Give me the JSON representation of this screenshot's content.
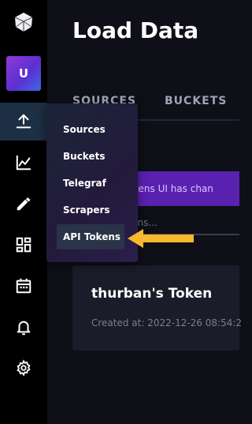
{
  "sidebar": {
    "logo_icon": "influx-cube-icon",
    "avatar_letter": "U",
    "items": [
      {
        "name": "load-data",
        "icon": "upload-icon",
        "active": true
      },
      {
        "name": "data-explorer",
        "icon": "chart-line-icon",
        "active": false
      },
      {
        "name": "notebooks",
        "icon": "pencil-icon",
        "active": false
      },
      {
        "name": "dashboards",
        "icon": "dashboard-grid-icon",
        "active": false
      },
      {
        "name": "tasks",
        "icon": "calendar-icon",
        "active": false
      },
      {
        "name": "alerts",
        "icon": "bell-icon",
        "active": false
      },
      {
        "name": "settings",
        "icon": "gear-icon",
        "active": false
      }
    ]
  },
  "header": {
    "title": "Load Data"
  },
  "tabs": [
    "SOURCES",
    "BUCKETS"
  ],
  "banner": {
    "text": "ur Tokens UI has chan"
  },
  "filter": {
    "placeholder": "Tokens..."
  },
  "token_card": {
    "title": "thurban's Token",
    "created": "Created at: 2022-12-26 08:54:2"
  },
  "dropdown": {
    "items": [
      "Sources",
      "Buckets",
      "Telegraf",
      "Scrapers",
      "API Tokens"
    ],
    "highlighted": "API Tokens"
  },
  "colors": {
    "sidebar": "#000000",
    "background": "#0e0f17",
    "banner": "#5a21b0",
    "arrow": "#f5b82e",
    "active_nav": "#1d2f44"
  }
}
